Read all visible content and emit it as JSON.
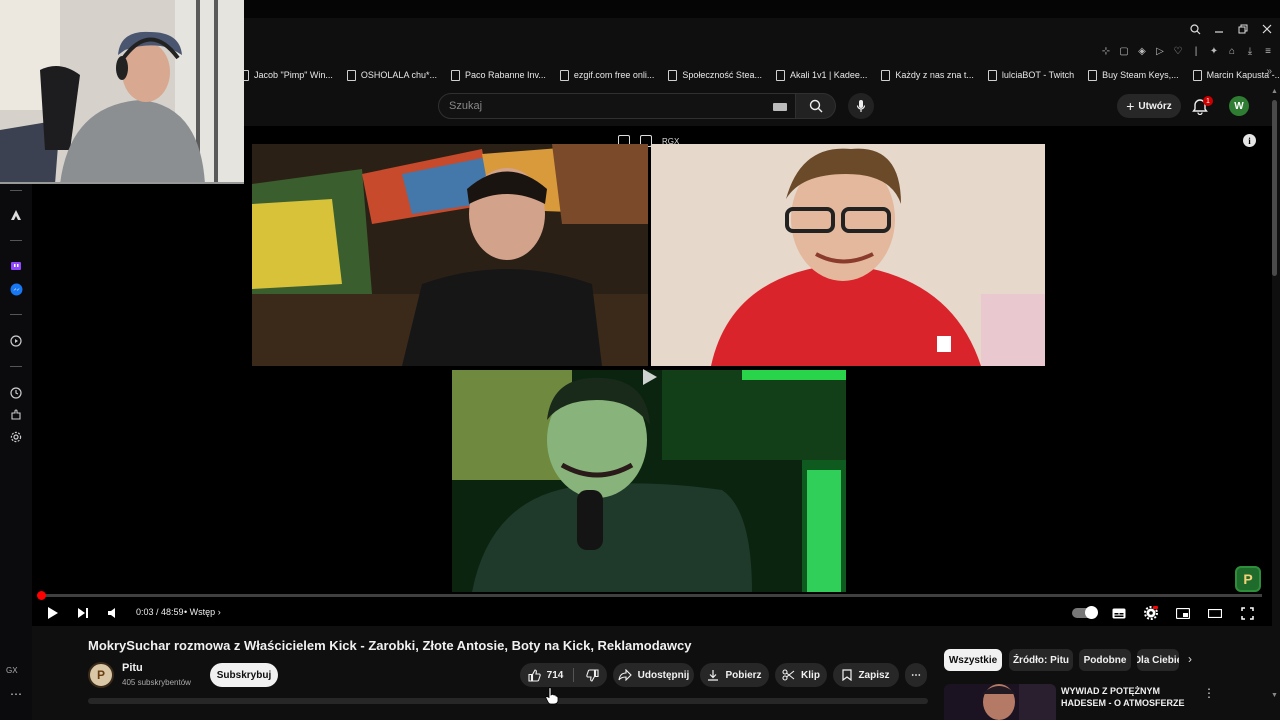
{
  "bookmarks": [
    {
      "label": "Jacob \"Pimp\" Win..."
    },
    {
      "label": "OSHOLALA chu*..."
    },
    {
      "label": "Paco Rabanne Inv..."
    },
    {
      "label": "ezgif.com free onli..."
    },
    {
      "label": "Społeczność Stea..."
    },
    {
      "label": "Akali 1v1 | Kadee..."
    },
    {
      "label": "Każdy z nas zna t..."
    },
    {
      "label": "lulciaBOT - Twitch"
    },
    {
      "label": "Buy Steam Keys,..."
    },
    {
      "label": "Marcin Kapusta -..."
    }
  ],
  "header": {
    "search_placeholder": "Szukaj",
    "create_label": "Utwórz",
    "notification_count": "1",
    "user_initial": "W"
  },
  "player": {
    "overlay_label": "RGX",
    "time": "0:03 / 48:59",
    "separator": "•",
    "chapter": "Wstęp",
    "progress": 0.001
  },
  "video": {
    "title": "MokrySuchar rozmowa z Właścicielem Kick - Zarobki, Złote Antosie, Boty na Kick, Reklamodawcy",
    "channel_name": "Pitu",
    "channel_subs": "405 subskrybentów",
    "subscribe_label": "Subskrybuj",
    "like_count": "714",
    "share_label": "Udostępnij",
    "download_label": "Pobierz",
    "clip_label": "Klip",
    "save_label": "Zapisz"
  },
  "chips": [
    {
      "label": "Wszystkie"
    },
    {
      "label": "Źródło: Pitu"
    },
    {
      "label": "Podobne"
    },
    {
      "label": "Dla Ciebie"
    }
  ],
  "recommendation": {
    "title": "WYWIAD Z POTĘŻNYM HADESEM - O ATMOSFERZE"
  },
  "sidebar": {
    "label": "GX"
  },
  "colors": {
    "accent": "#ff0000",
    "background": "#0f0f0f",
    "avatar_bg": "#2e7d32"
  }
}
